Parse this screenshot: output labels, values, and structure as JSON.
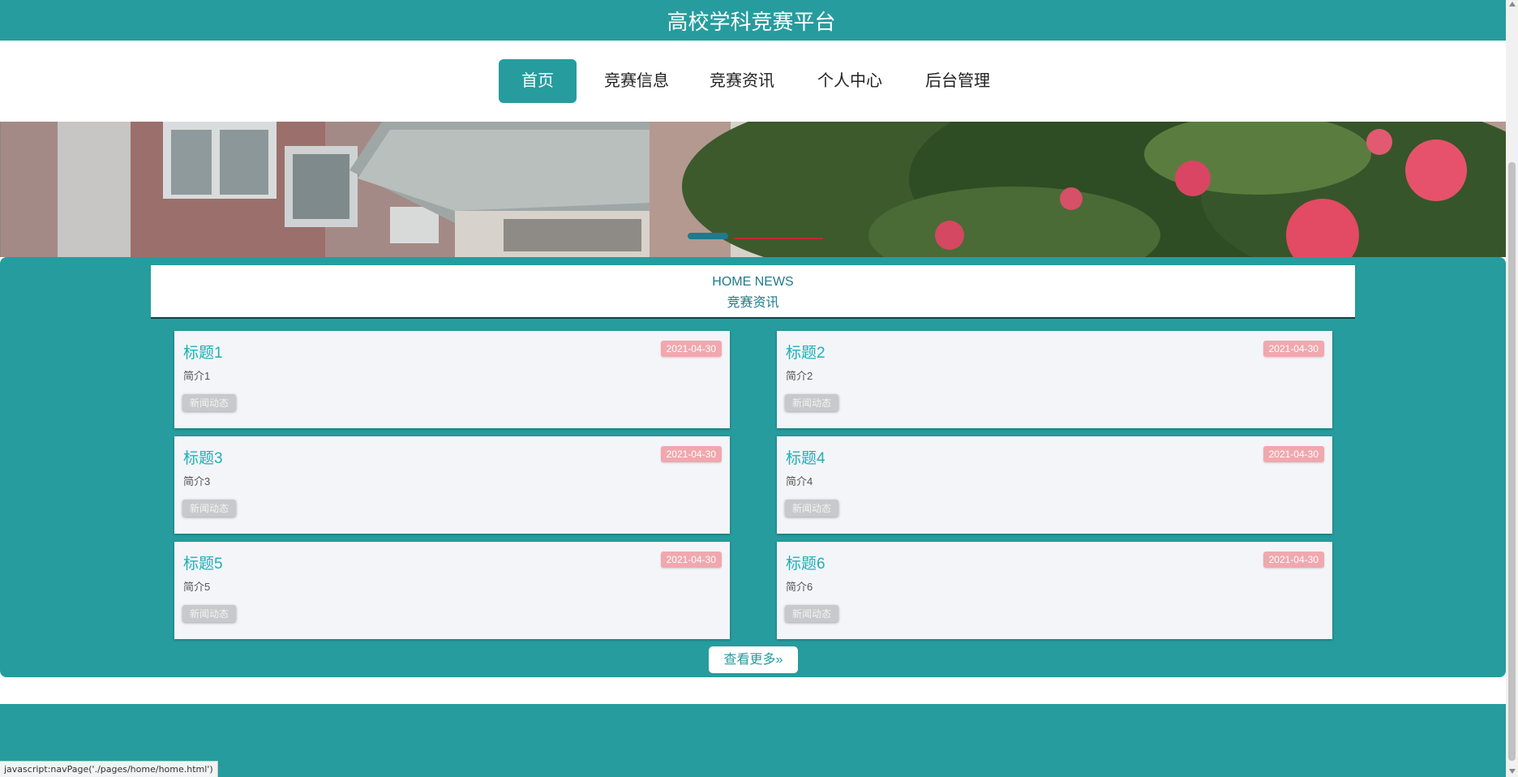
{
  "header": {
    "title": "高校学科竞赛平台"
  },
  "nav": {
    "items": [
      {
        "label": "首页",
        "active": true
      },
      {
        "label": "竞赛信息",
        "active": false
      },
      {
        "label": "竞赛资讯",
        "active": false
      },
      {
        "label": "个人中心",
        "active": false
      },
      {
        "label": "后台管理",
        "active": false
      }
    ]
  },
  "news": {
    "header_en": "HOME NEWS",
    "header_cn": "竞赛资讯",
    "cards": [
      {
        "title": "标题1",
        "date": "2021-04-30",
        "desc": "简介1",
        "tag": "新闻动态"
      },
      {
        "title": "标题2",
        "date": "2021-04-30",
        "desc": "简介2",
        "tag": "新闻动态"
      },
      {
        "title": "标题3",
        "date": "2021-04-30",
        "desc": "简介3",
        "tag": "新闻动态"
      },
      {
        "title": "标题4",
        "date": "2021-04-30",
        "desc": "简介4",
        "tag": "新闻动态"
      },
      {
        "title": "标题5",
        "date": "2021-04-30",
        "desc": "简介5",
        "tag": "新闻动态"
      },
      {
        "title": "标题6",
        "date": "2021-04-30",
        "desc": "简介6",
        "tag": "新闻动态"
      }
    ],
    "more_label": "查看更多",
    "more_icon": "double-chevron-right-icon"
  },
  "status_bar": {
    "text": "javascript:navPage('./pages/home/home.html')"
  },
  "colors": {
    "primary": "#269c9e",
    "date_badge": "#f0a8ae",
    "card_bg": "#f3f5f9",
    "title_text": "#20b0b6"
  }
}
